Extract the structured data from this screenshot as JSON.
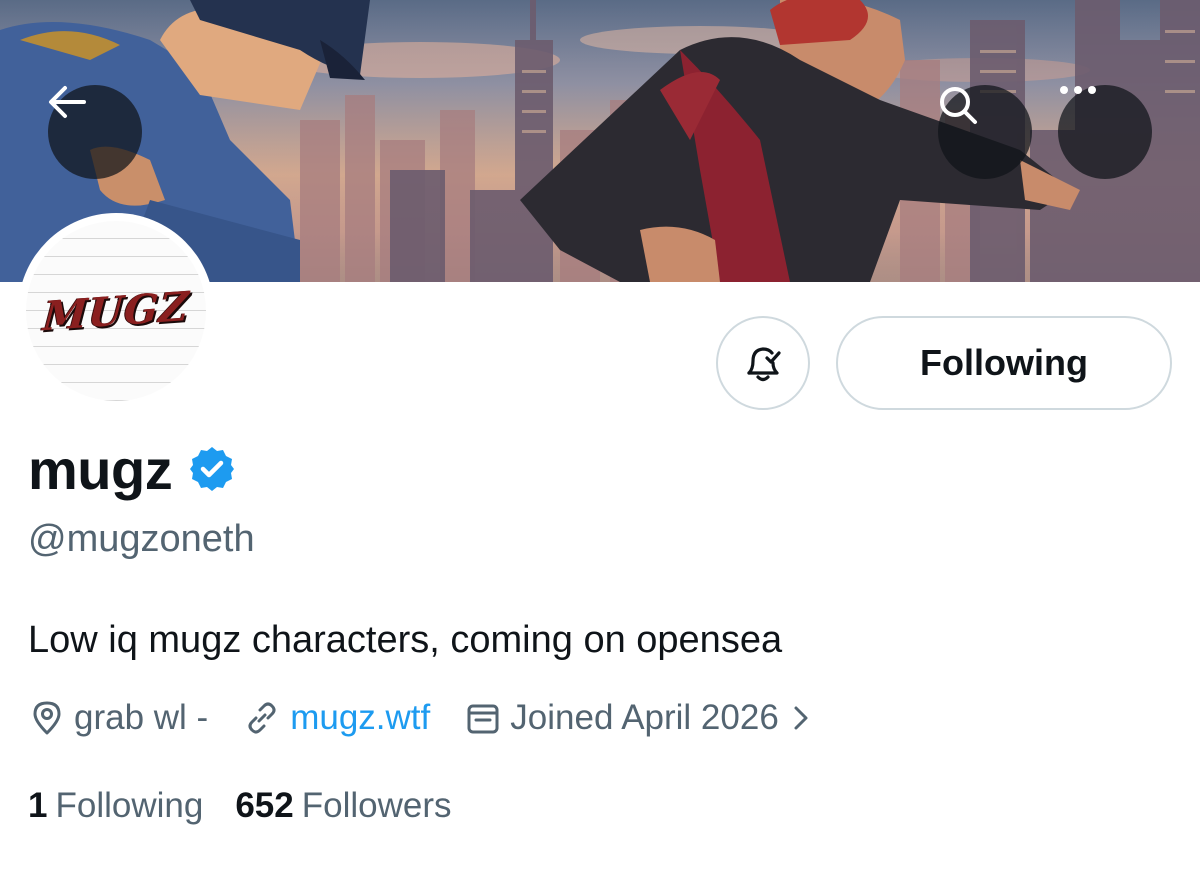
{
  "header": {
    "back_icon": "arrow-left-icon",
    "search_icon": "search-icon",
    "more_icon": "more-horizontal-icon"
  },
  "avatar": {
    "logo_text": "MUGZ"
  },
  "actions": {
    "notify_icon": "bell-check-icon",
    "following_label": "Following"
  },
  "profile": {
    "display_name": "mugz",
    "verified_icon": "verified-badge-icon",
    "handle": "@mugzoneth",
    "bio": "Low iq mugz characters, coming on opensea",
    "location": "grab wl -",
    "website": "mugz.wtf",
    "joined": "Joined April 2026"
  },
  "stats": {
    "following_count": "1",
    "following_label": "Following",
    "followers_count": "652",
    "followers_label": "Followers"
  },
  "colors": {
    "text_primary": "#0f1419",
    "text_secondary": "#536471",
    "link": "#1d9bf0",
    "border": "#cfd9de",
    "verified": "#1d9bf0"
  }
}
